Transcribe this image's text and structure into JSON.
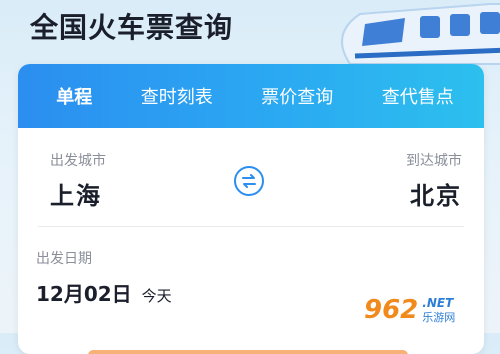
{
  "header": {
    "title": "全国火车票查询"
  },
  "tabs": [
    {
      "label": "单程",
      "active": true
    },
    {
      "label": "查时刻表",
      "active": false
    },
    {
      "label": "票价查询",
      "active": false
    },
    {
      "label": "查代售点",
      "active": false
    }
  ],
  "route": {
    "from_label": "出发城市",
    "from_city": "上海",
    "to_label": "到达城市",
    "to_city": "北京",
    "swap_icon": "swap-arrows-icon"
  },
  "date": {
    "label": "出发日期",
    "value": "12月02日",
    "hint": "今天"
  },
  "watermark": {
    "main": "962",
    "sub_en": ".NET",
    "sub_cn": "乐游网"
  },
  "colors": {
    "accent": "#2b8ef0",
    "tab_bar_end": "#2cc0ee",
    "text": "#1a1f2b",
    "muted": "#8a8f99"
  }
}
